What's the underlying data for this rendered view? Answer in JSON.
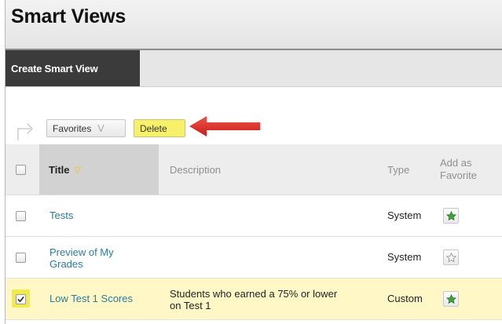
{
  "page": {
    "title": "Smart Views"
  },
  "actionbar": {
    "create_label": "Create Smart View"
  },
  "toolbar": {
    "favorites_label": "Favorites",
    "delete_label": "Delete"
  },
  "table": {
    "headers": {
      "title": "Title",
      "description": "Description",
      "type": "Type",
      "fav_line1": "Add as",
      "fav_line2": "Favorite"
    },
    "rows": [
      {
        "title": "Tests",
        "title_line2": "",
        "description": "",
        "description_line2": "",
        "type": "System",
        "favorite": true,
        "checked": false
      },
      {
        "title": "Preview of My",
        "title_line2": "Grades",
        "description": "",
        "description_line2": "",
        "type": "System",
        "favorite": false,
        "checked": false
      },
      {
        "title": "Low Test 1 Scores",
        "title_line2": "",
        "description": "Students who earned a 75% or lower",
        "description_line2": "on Test 1",
        "type": "Custom",
        "favorite": true,
        "checked": true
      }
    ]
  },
  "colors": {
    "accent_star": "#3aa33a",
    "highlight": "#f1ea4a",
    "arrow": "#e0322c"
  }
}
